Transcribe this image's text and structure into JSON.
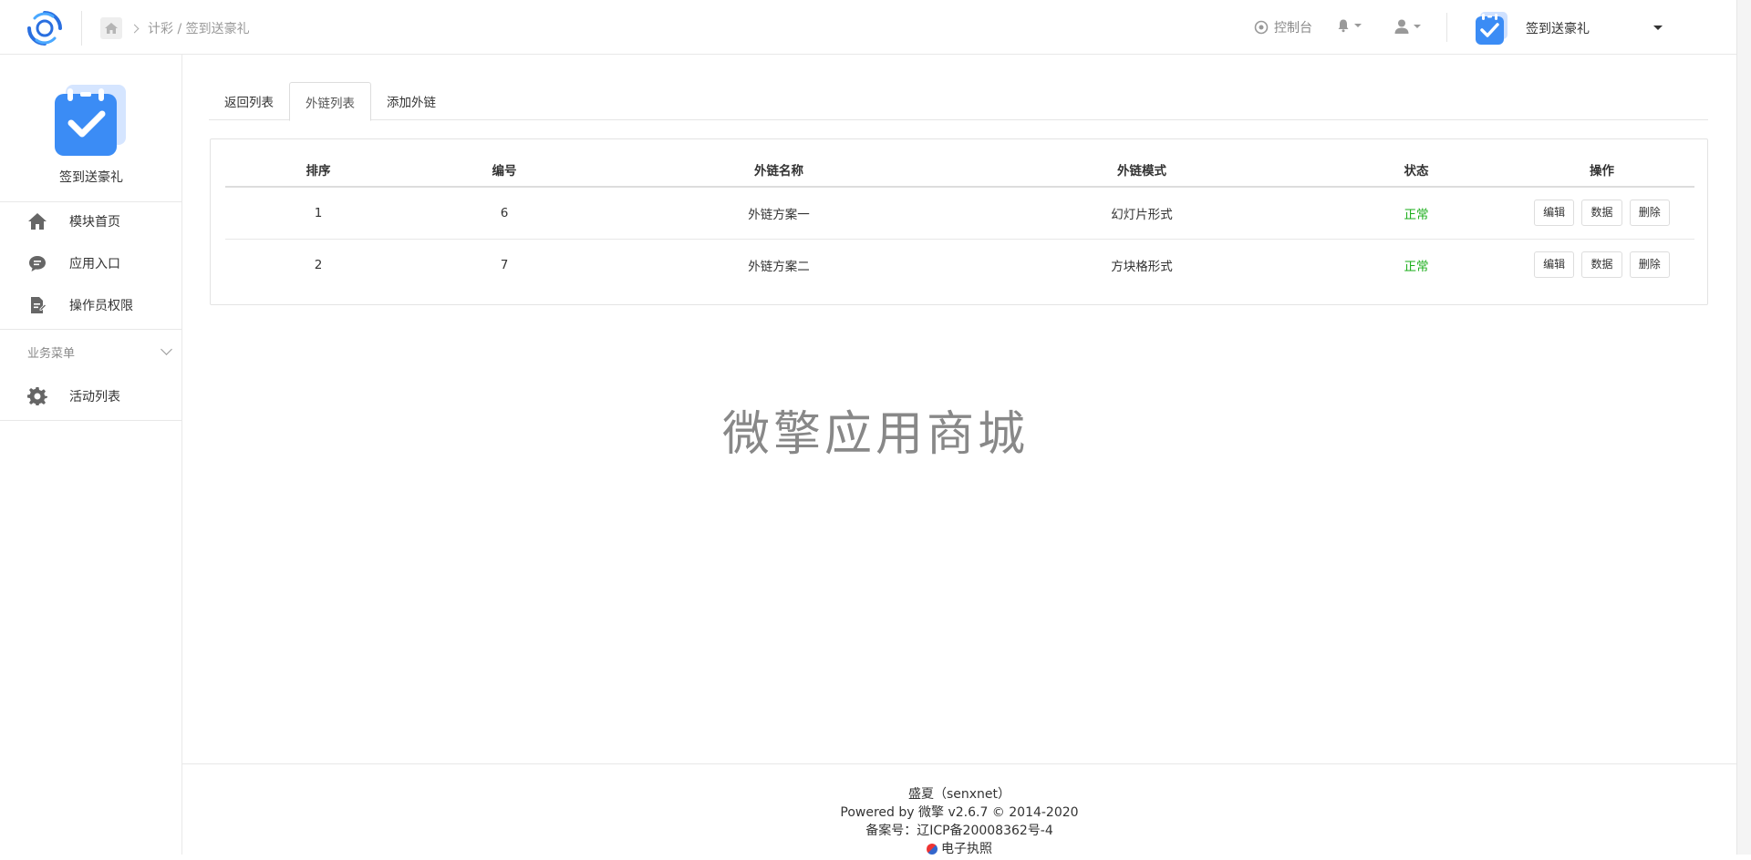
{
  "header": {
    "breadcrumb": "计彩 / 签到送豪礼",
    "console_label": "控制台",
    "app_name": "签到送豪礼"
  },
  "sidebar": {
    "app_name": "签到送豪礼",
    "items": [
      {
        "label": "模块首页",
        "icon": "home-icon"
      },
      {
        "label": "应用入口",
        "icon": "chat-icon"
      },
      {
        "label": "操作员权限",
        "icon": "doc-edit-icon"
      }
    ],
    "group_label": "业务菜单",
    "group_items": [
      {
        "label": "活动列表",
        "icon": "gear-icon"
      }
    ]
  },
  "tabs": [
    {
      "label": "返回列表",
      "active": false
    },
    {
      "label": "外链列表",
      "active": true
    },
    {
      "label": "添加外链",
      "active": false
    }
  ],
  "table": {
    "headers": [
      "排序",
      "编号",
      "外链名称",
      "外链模式",
      "状态",
      "操作"
    ],
    "rows": [
      {
        "order": "1",
        "id": "6",
        "name": "外链方案一",
        "mode": "幻灯片形式",
        "status": "正常"
      },
      {
        "order": "2",
        "id": "7",
        "name": "外链方案二",
        "mode": "方块格形式",
        "status": "正常"
      }
    ],
    "actions": {
      "edit": "编辑",
      "data": "数据",
      "delete": "删除"
    }
  },
  "watermark": "微擎应用商城",
  "footer": {
    "company": "盛夏（senxnet）",
    "powered": "Powered by 微擎 v2.6.7 © 2014-2020",
    "icp": "备案号：辽ICP备20008362号-4",
    "license": "电子执照"
  },
  "colors": {
    "status_ok": "#1aad19",
    "accent": "#3b8cf5"
  }
}
